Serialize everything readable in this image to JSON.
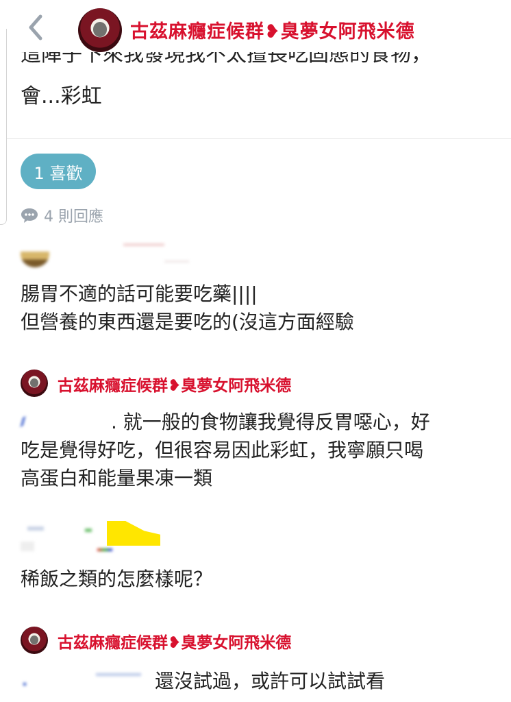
{
  "header": {
    "author_name": "古茲麻癮症候群❥臭夢女阿飛米德",
    "back_icon": "chevron-left-icon"
  },
  "post": {
    "text_line1": "這陣子下來我發現我不太擅長吃固態的食物，",
    "text_line2": "會...彩虹"
  },
  "likes": {
    "label": "1 喜歡"
  },
  "replies": {
    "count_label": "4 則回應",
    "icon": "speech-bubble-icon"
  },
  "comments": [
    {
      "lines": [
        "腸胃不適的話可能要吃藥||||",
        "但營養的東西還是要吃的(沒這方面經驗"
      ]
    },
    {
      "author": "古茲麻癮症候群❥臭夢女阿飛米德",
      "first_line": ". 就一般的食物讓我覺得反胃噁心，好",
      "lines": [
        "吃是覺得好吃，但很容易因此彩虹，我寧願只喝",
        "高蛋白和能量果凍一類"
      ]
    },
    {
      "lines": [
        "稀飯之類的怎麼樣呢？"
      ]
    },
    {
      "author": "古茲麻癮症候群❥臭夢女阿飛米德",
      "first_line": "還沒試過，或許可以試試看"
    }
  ],
  "colors": {
    "author_red": "#d8112e",
    "like_pill": "#5fb0c4",
    "muted_grey": "#9aa3ad"
  }
}
